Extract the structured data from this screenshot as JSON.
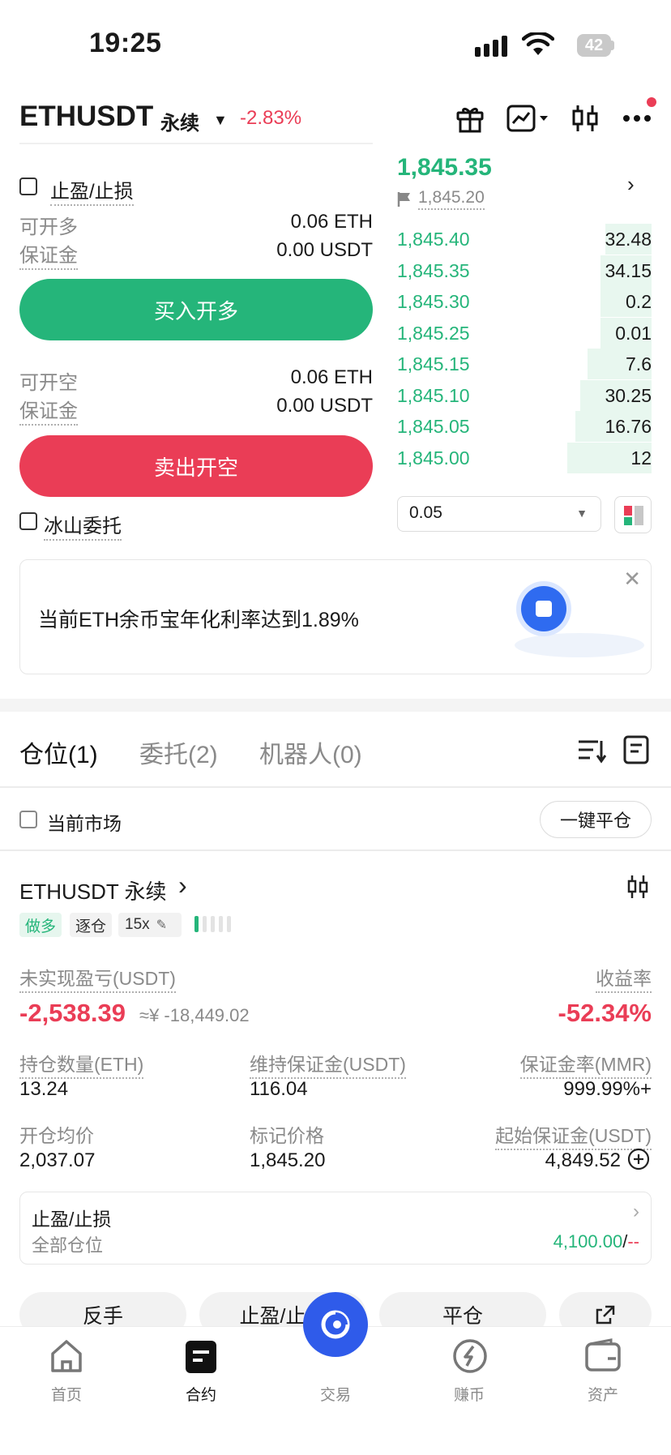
{
  "status_bar": {
    "time": "19:25",
    "battery": "42"
  },
  "header": {
    "symbol": "ETHUSDT",
    "contract_type": "永续",
    "change": "-2.83%",
    "icons": [
      "gift-icon",
      "chart-icon",
      "candlestick-icon",
      "more-icon"
    ]
  },
  "form": {
    "tp_sl_label": "止盈/止损",
    "long": {
      "available_label": "可开多",
      "available_value": "0.06 ETH",
      "margin_label": "保证金",
      "margin_value": "0.00 USDT",
      "button": "买入开多"
    },
    "short": {
      "available_label": "可开空",
      "available_value": "0.06 ETH",
      "margin_label": "保证金",
      "margin_value": "0.00 USDT",
      "button": "卖出开空"
    },
    "iceberg_label": "冰山委托"
  },
  "orderbook": {
    "last_price": "1,845.35",
    "mark_price": "1,845.20",
    "rows": [
      {
        "price": "1,845.40",
        "qty": "32.48",
        "depth": 0.18
      },
      {
        "price": "1,845.35",
        "qty": "34.15",
        "depth": 0.2
      },
      {
        "price": "1,845.30",
        "qty": "0.2",
        "depth": 0.2
      },
      {
        "price": "1,845.25",
        "qty": "0.01",
        "depth": 0.2
      },
      {
        "price": "1,845.15",
        "qty": "7.6",
        "depth": 0.25
      },
      {
        "price": "1,845.10",
        "qty": "30.25",
        "depth": 0.28
      },
      {
        "price": "1,845.05",
        "qty": "16.76",
        "depth": 0.3
      },
      {
        "price": "1,845.00",
        "qty": "12",
        "depth": 0.33
      }
    ],
    "precision": "0.05"
  },
  "banner": {
    "text": "当前ETH余币宝年化利率达到1.89%"
  },
  "tabs": [
    {
      "label": "仓位(1)",
      "active": true
    },
    {
      "label": "委托(2)",
      "active": false
    },
    {
      "label": "机器人(0)",
      "active": false
    }
  ],
  "filter": {
    "current_market_label": "当前市场",
    "close_all_button": "一键平仓"
  },
  "position": {
    "title": "ETHUSDT 永续",
    "side_tag": "做多",
    "margin_mode_tag": "逐仓",
    "leverage_tag": "15x",
    "unrealized_pnl_label": "未实现盈亏(USDT)",
    "unrealized_pnl": "-2,538.39",
    "unrealized_pnl_cny": "≈¥ -18,449.02",
    "roe_label": "收益率",
    "roe": "-52.34%",
    "size_label": "持仓数量(ETH)",
    "size": "13.24",
    "maint_margin_label": "维持保证金(USDT)",
    "maint_margin": "116.04",
    "mmr_label": "保证金率(MMR)",
    "mmr": "999.99%+",
    "entry_label": "开仓均价",
    "entry": "2,037.07",
    "mark_label": "标记价格",
    "mark": "1,845.20",
    "init_margin_label": "起始保证金(USDT)",
    "init_margin": "4,849.52",
    "tp_sl_title": "止盈/止损",
    "tp_sl_scope": "全部仓位",
    "tp_value": "4,100.00",
    "sl_value": "--"
  },
  "actions": [
    "反手",
    "止盈/止损",
    "平仓"
  ],
  "bottom_nav": [
    {
      "label": "首页",
      "icon": "home-icon",
      "active": false
    },
    {
      "label": "合约",
      "icon": "contract-icon",
      "active": true
    },
    {
      "label": "交易",
      "icon": "trade-icon",
      "active": false
    },
    {
      "label": "赚币",
      "icon": "earn-icon",
      "active": false
    },
    {
      "label": "资产",
      "icon": "wallet-icon",
      "active": false
    }
  ],
  "colors": {
    "green": "#25b57a",
    "red": "#ea3d56",
    "blue": "#2f5bea"
  }
}
